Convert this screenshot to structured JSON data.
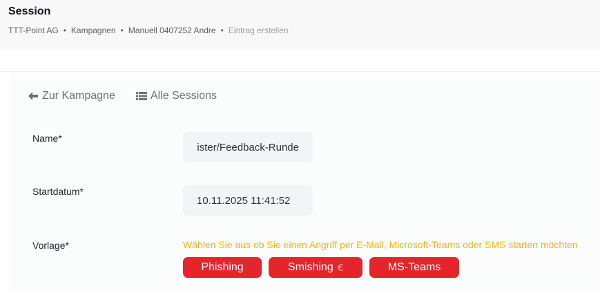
{
  "header": {
    "title": "Session",
    "breadcrumb": [
      {
        "label": "TTT-Point AG"
      },
      {
        "label": "Kampagnen"
      },
      {
        "label": "Manuell 0407252 Andre"
      },
      {
        "label": "Eintrag erstellen"
      }
    ],
    "separator": "•"
  },
  "nav": {
    "back_label": "Zur Kampagne",
    "back_icon": "arrow-left-icon",
    "sessions_label": "Alle Sessions",
    "sessions_icon": "list-icon"
  },
  "form": {
    "name": {
      "label": "Name*",
      "value": "eister/Feedback-Runde"
    },
    "startdate": {
      "label": "Startdatum*",
      "value": "10.11.2025 11:41:52"
    },
    "template": {
      "label": "Vorlage*",
      "hint": "Wählen Sie aus ob Sie einen Angriff per E-Mail, Microsoft-Teams oder SMS starten möchten",
      "options": [
        {
          "label": "Phishing"
        },
        {
          "label": "Smishing",
          "icon": "euro-icon",
          "icon_glyph": "€"
        },
        {
          "label": "MS-Teams"
        }
      ]
    }
  },
  "colors": {
    "accent_button": "#e5252c",
    "hint_text": "#f5b400",
    "header_bg": "#f8f8f9"
  }
}
